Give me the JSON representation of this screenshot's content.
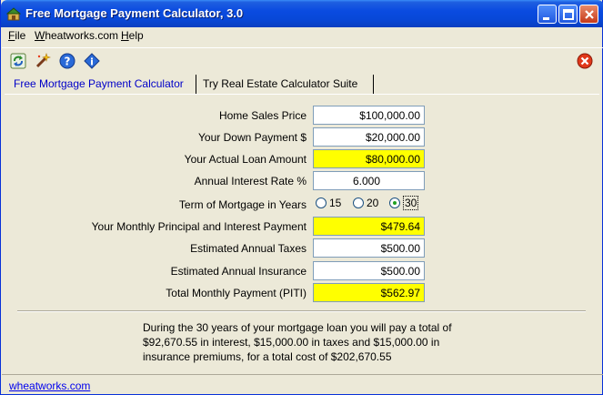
{
  "window": {
    "title": "Free Mortgage Payment Calculator, 3.0"
  },
  "menu": [
    {
      "label": "File",
      "underline_index": 0
    },
    {
      "label": "Wheatworks.com",
      "underline_index": 0
    },
    {
      "label": "Help",
      "underline_index": 0
    }
  ],
  "toolbar": {
    "icons": [
      "refresh-icon",
      "magic-wand-icon",
      "help-icon",
      "info-icon"
    ],
    "close_icon": "close-icon"
  },
  "tabs": [
    {
      "label": "Free Mortgage Payment Calculator",
      "active": true
    },
    {
      "label": "Try Real Estate Calculator Suite",
      "active": false
    }
  ],
  "form": {
    "home_sales_price": {
      "label": "Home Sales Price",
      "value": "$100,000.00"
    },
    "down_payment": {
      "label": "Your Down Payment $",
      "value": "$20,000.00"
    },
    "loan_amount": {
      "label": "Your Actual Loan Amount",
      "value": "$80,000.00"
    },
    "interest_rate": {
      "label": "Annual Interest Rate %",
      "value": "6.000"
    },
    "term": {
      "label": "Term of Mortgage in Years",
      "options": [
        "15",
        "20",
        "30"
      ],
      "selected": "30"
    },
    "monthly_pi": {
      "label": "Your Monthly Principal and Interest Payment",
      "value": "$479.64"
    },
    "annual_taxes": {
      "label": "Estimated Annual Taxes",
      "value": "$500.00"
    },
    "annual_insurance": {
      "label": "Estimated Annual Insurance",
      "value": "$500.00"
    },
    "total_monthly": {
      "label": "Total Monthly Payment (PITI)",
      "value": "$562.97"
    }
  },
  "summary": {
    "line1": "During the 30 years of your mortgage loan you will pay a total of",
    "line2": "$92,670.55 in interest, $15,000.00 in taxes and $15,000.00 in",
    "line3": "insurance premiums, for a total cost of $202,670.55"
  },
  "status": {
    "link": "wheatworks.com"
  },
  "colors": {
    "highlight": "#ffff00",
    "titlebar": "#0a4be0",
    "link": "#0000ee"
  }
}
